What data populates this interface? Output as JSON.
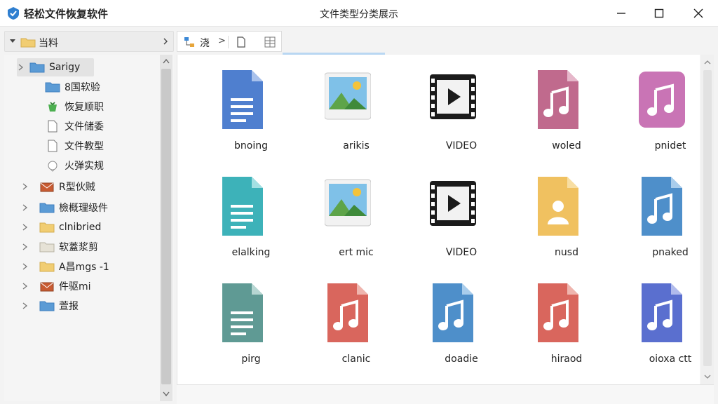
{
  "app": {
    "title": "轻松文件恢复软件",
    "window_title": "文件类型分类展示",
    "colors": {
      "titlebar": "#ffffff",
      "sidebar": "#f5f5f5",
      "accent": "#3b88d6"
    }
  },
  "left_pane": {
    "root_label": "当料",
    "tree": [
      {
        "label": "Sarigy",
        "icon": "folder-blue-icon",
        "selected": true
      },
      {
        "label": "8国软验",
        "icon": "folder-blue-icon"
      },
      {
        "label": "恢复顺职",
        "icon": "recycle-icon"
      },
      {
        "label": "文件储委",
        "icon": "document-icon"
      },
      {
        "label": "文件教型",
        "icon": "document-icon"
      },
      {
        "label": "火弹实规",
        "icon": "bubble-icon"
      },
      {
        "label": "R型伙贼",
        "icon": "mail-icon"
      },
      {
        "label": "檢概理级件",
        "icon": "folder-blue-icon"
      },
      {
        "label": "clnibried",
        "icon": "folder-yellow-icon"
      },
      {
        "label": "软蓋浆剪",
        "icon": "folder-gray-icon"
      },
      {
        "label": "A昌mgs -1",
        "icon": "folder-yellow-icon",
        "badge": "ˢ"
      },
      {
        "label": "件驱mi",
        "icon": "mail-icon"
      },
      {
        "label": "萱报",
        "icon": "folder-blue-icon"
      }
    ]
  },
  "toolbar": {
    "back_label": "浇",
    "nav_chevron": ">"
  },
  "files": [
    {
      "name": "bnoing",
      "icon": "document-blue-icon"
    },
    {
      "name": "arikis",
      "icon": "image-icon"
    },
    {
      "name": "VIDEO",
      "icon": "video-icon"
    },
    {
      "name": "woled",
      "icon": "music-mauve-icon"
    },
    {
      "name": "pnidet",
      "icon": "music-pink-icon"
    },
    {
      "name": "elalking",
      "icon": "document-teal-icon"
    },
    {
      "name": "ert mic",
      "icon": "image-icon"
    },
    {
      "name": "VIDEO",
      "icon": "video-icon"
    },
    {
      "name": "nusd",
      "icon": "person-file-icon"
    },
    {
      "name": "pnaked",
      "icon": "music-blue-icon"
    },
    {
      "name": "pirg",
      "icon": "document-green-icon"
    },
    {
      "name": "clanic",
      "icon": "music-red-icon"
    },
    {
      "name": "doadie",
      "icon": "music-blue-icon"
    },
    {
      "name": "hiraod",
      "icon": "music-red-icon"
    },
    {
      "name": "oioxa ctt",
      "icon": "music-indigo-icon"
    }
  ]
}
